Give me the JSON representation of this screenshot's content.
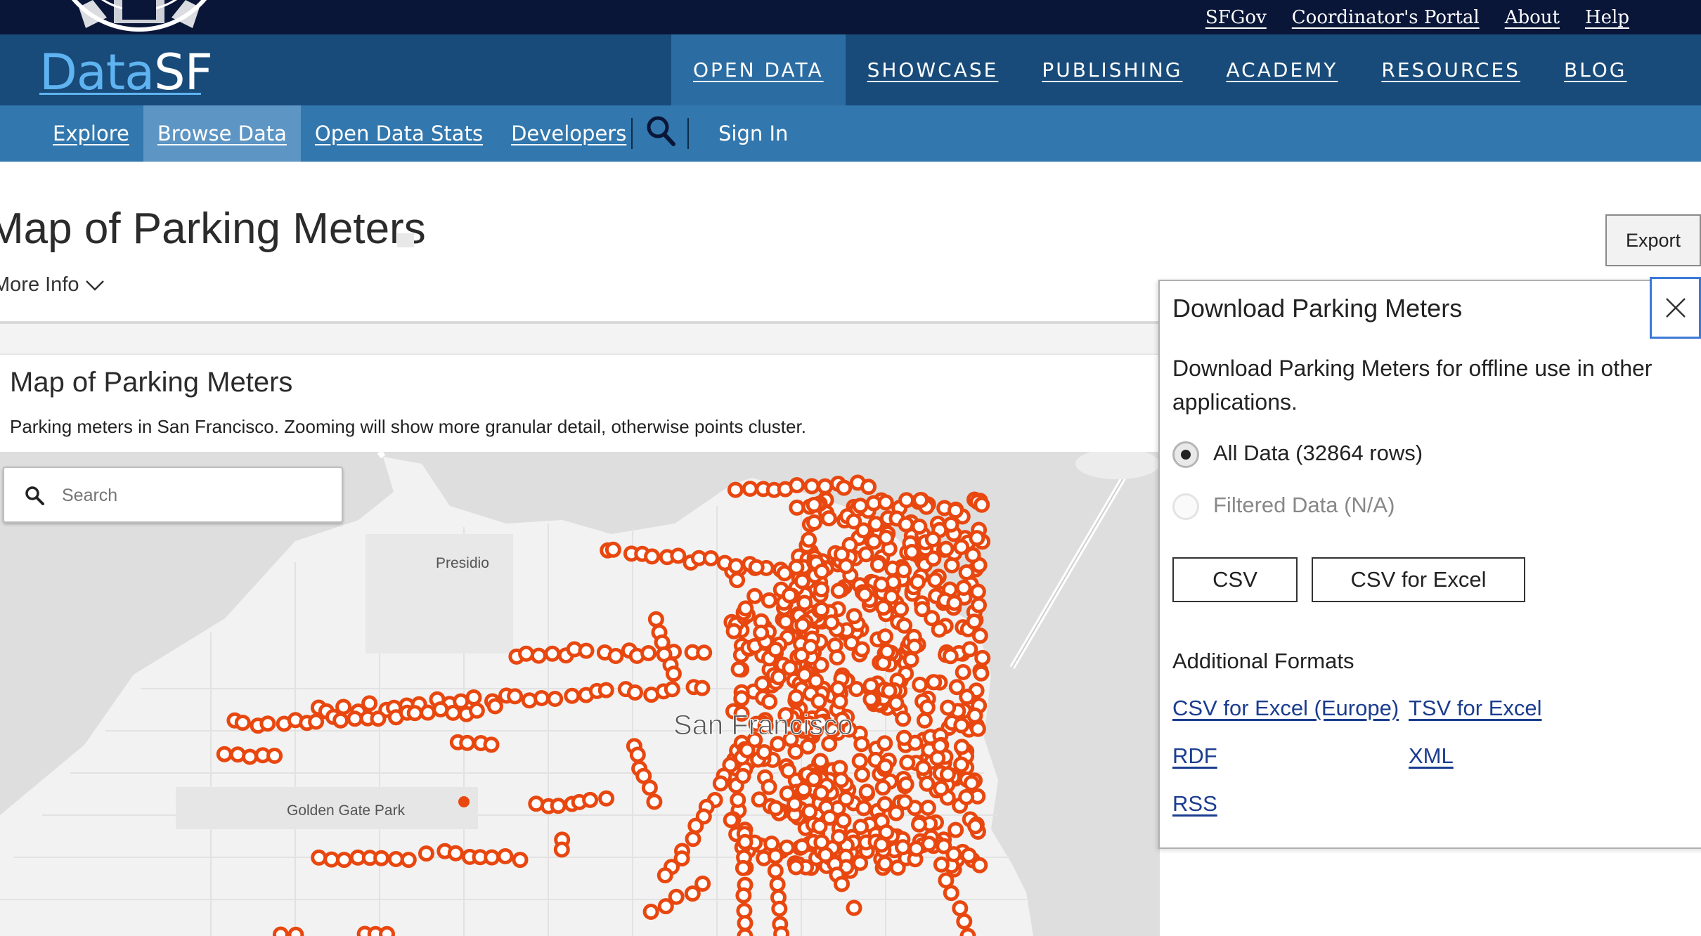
{
  "top_links": [
    "SFGov",
    "Coordinator's Portal",
    "About",
    "Help"
  ],
  "logo": {
    "part1": "Data",
    "part2": "SF"
  },
  "main_nav": [
    {
      "label": "OPEN DATA",
      "active": true
    },
    {
      "label": "SHOWCASE",
      "active": false
    },
    {
      "label": "PUBLISHING",
      "active": false
    },
    {
      "label": "ACADEMY",
      "active": false
    },
    {
      "label": "RESOURCES",
      "active": false
    },
    {
      "label": "BLOG",
      "active": false
    }
  ],
  "sub_nav": [
    {
      "label": "Explore",
      "active": false
    },
    {
      "label": "Browse Data",
      "active": true
    },
    {
      "label": "Open Data Stats",
      "active": false
    },
    {
      "label": "Developers",
      "active": false
    }
  ],
  "sign_in": "Sign In",
  "page": {
    "title": "Map of Parking Meters",
    "more_info": "More Info",
    "export_label": "Export"
  },
  "viz": {
    "title": "Map of Parking Meters",
    "description": "Parking meters in San Francisco. Zooming will show more granular detail, otherwise points cluster."
  },
  "map": {
    "search_placeholder": "Search",
    "labels": [
      "Presidio",
      "San Francisco",
      "Golden Gate Park"
    ],
    "marker_color": "#e8470f"
  },
  "download_panel": {
    "title": "Download Parking Meters",
    "description": "Download Parking Meters for offline use in other applications.",
    "options": [
      {
        "label": "All Data (32864 rows)",
        "selected": true,
        "enabled": true
      },
      {
        "label": "Filtered Data (N/A)",
        "selected": false,
        "enabled": false
      }
    ],
    "buttons": [
      "CSV",
      "CSV for Excel"
    ],
    "additional_heading": "Additional Formats",
    "formats": [
      "CSV for Excel (Europe)",
      "TSV for Excel",
      "RDF",
      "XML",
      "RSS"
    ]
  },
  "colors": {
    "top_bar": "#0a1638",
    "main_nav": "#184b7a",
    "sub_nav": "#3277ad",
    "accent": "#5fb3f0",
    "link": "#1b3d8f"
  }
}
